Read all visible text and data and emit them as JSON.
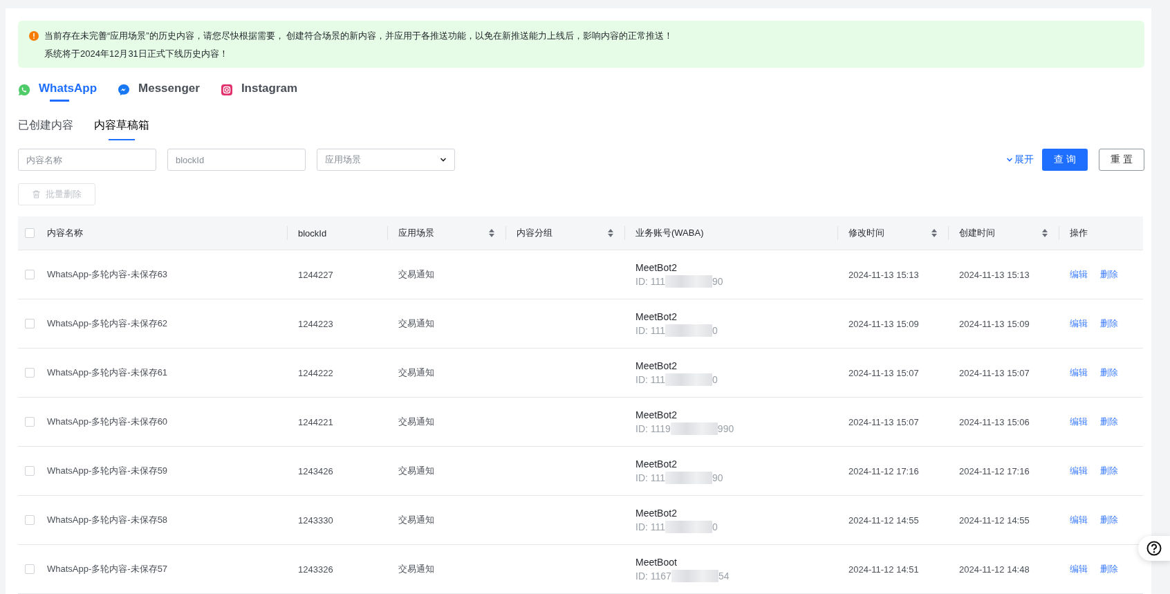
{
  "notice": {
    "lines": [
      "当前存在未完善“应用场景”的历史内容，请您尽快根据需要， 创建符合场景的新内容，并应用于各推送功能，以免在新推送能力上线后，影响内容的正常推送！",
      "系统将于2024年12月31日正式下线历史内容！"
    ]
  },
  "channel_tabs": [
    {
      "label": "WhatsApp",
      "kind": "whatsapp",
      "selected": true
    },
    {
      "label": "Messenger",
      "kind": "messenger",
      "selected": false
    },
    {
      "label": "Instagram",
      "kind": "instagram",
      "selected": false
    }
  ],
  "sub_tabs": [
    {
      "label": "已创建内容",
      "selected": false
    },
    {
      "label": "内容草稿箱",
      "selected": true
    }
  ],
  "filters": {
    "name": {
      "placeholder": "内容名称"
    },
    "block_id": {
      "placeholder": "blockId"
    },
    "scene": {
      "placeholder": "应用场景"
    },
    "expand": "展开",
    "query": "查 询",
    "reset": "重 置"
  },
  "batch_delete": {
    "label": "批量删除",
    "disabled": true
  },
  "table": {
    "all_checked": false,
    "columns": [
      {
        "label": "内容名称",
        "sortable": false
      },
      {
        "label": "blockId",
        "sortable": false
      },
      {
        "label": "应用场景",
        "sortable": true
      },
      {
        "label": "内容分组",
        "sortable": true
      },
      {
        "label": "业务账号(WABA)",
        "sortable": false
      },
      {
        "label": "修改时间",
        "sortable": true
      },
      {
        "label": "创建时间",
        "sortable": true
      },
      {
        "label": "操作",
        "sortable": false
      }
    ],
    "rows": [
      {
        "checked": false,
        "name": "WhatsApp-多轮内容-未保存63",
        "block_id": "1244227",
        "scene": "交易通知",
        "account": "MeetBot2",
        "id_prefix": "ID: 111",
        "id_suffix": "90",
        "modified": "2024-11-13 15:13",
        "created": "2024-11-13 15:13",
        "actions": [
          "编辑",
          "删除"
        ]
      },
      {
        "checked": false,
        "name": "WhatsApp-多轮内容-未保存62",
        "block_id": "1244223",
        "scene": "交易通知",
        "account": "MeetBot2",
        "id_prefix": "ID: 111",
        "id_suffix": "0",
        "modified": "2024-11-13 15:09",
        "created": "2024-11-13 15:09",
        "actions": [
          "编辑",
          "删除"
        ]
      },
      {
        "checked": false,
        "name": "WhatsApp-多轮内容-未保存61",
        "block_id": "1244222",
        "scene": "交易通知",
        "account": "MeetBot2",
        "id_prefix": "ID: 111",
        "id_suffix": "0",
        "modified": "2024-11-13 15:07",
        "created": "2024-11-13 15:07",
        "actions": [
          "编辑",
          "删除"
        ]
      },
      {
        "checked": false,
        "name": "WhatsApp-多轮内容-未保存60",
        "block_id": "1244221",
        "scene": "交易通知",
        "account": "MeetBot2",
        "id_prefix": "ID: 1119",
        "id_suffix": "990",
        "modified": "2024-11-13 15:07",
        "created": "2024-11-13 15:06",
        "actions": [
          "编辑",
          "删除"
        ]
      },
      {
        "checked": false,
        "name": "WhatsApp-多轮内容-未保存59",
        "block_id": "1243426",
        "scene": "交易通知",
        "account": "MeetBot2",
        "id_prefix": "ID: 111",
        "id_suffix": "90",
        "modified": "2024-11-12 17:16",
        "created": "2024-11-12 17:16",
        "actions": [
          "编辑",
          "删除"
        ]
      },
      {
        "checked": false,
        "name": "WhatsApp-多轮内容-未保存58",
        "block_id": "1243330",
        "scene": "交易通知",
        "account": "MeetBot2",
        "id_prefix": "ID: 111",
        "id_suffix": "0",
        "modified": "2024-11-12 14:55",
        "created": "2024-11-12 14:55",
        "actions": [
          "编辑",
          "删除"
        ]
      },
      {
        "checked": false,
        "name": "WhatsApp-多轮内容-未保存57",
        "block_id": "1243326",
        "scene": "交易通知",
        "account": "MeetBoot",
        "id_prefix": "ID: 1167",
        "id_suffix": "54",
        "modified": "2024-11-12 14:51",
        "created": "2024-11-12 14:48",
        "actions": [
          "编辑",
          "删除"
        ]
      }
    ]
  }
}
